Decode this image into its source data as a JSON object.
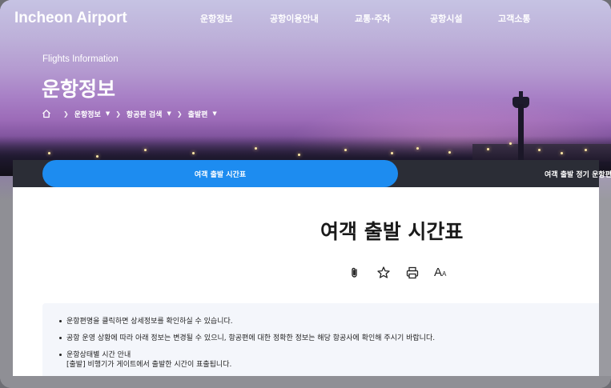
{
  "header": {
    "logo": "Incheon Airport",
    "nav": [
      {
        "label": "운항정보"
      },
      {
        "label": "공항이용안내"
      },
      {
        "label": "교통·주차"
      },
      {
        "label": "공항시설"
      },
      {
        "label": "고객소통"
      }
    ]
  },
  "hero": {
    "subtitle": "Flights Information",
    "title": "운항정보",
    "breadcrumb": [
      {
        "label": "운항정보"
      },
      {
        "label": "항공편 검색"
      },
      {
        "label": "출발편"
      }
    ]
  },
  "tabs": [
    {
      "label": "여객 출발 시간표",
      "active": true
    },
    {
      "label": "여객 출발 정기 운항편",
      "active": false
    }
  ],
  "main": {
    "title": "여객 출발 시간표",
    "tools": [
      {
        "icon": "link-icon"
      },
      {
        "icon": "star-icon"
      },
      {
        "icon": "print-icon"
      },
      {
        "icon": "font-size-icon",
        "label": "A",
        "label_small": "A"
      }
    ],
    "notice": [
      {
        "text": "운항편명을 클릭하면 상세정보를 확인하실 수 있습니다."
      },
      {
        "text": "공항 운영 상황에 따라 아래 정보는 변경될 수 있으니, 항공편에 대한 정확한 정보는 해당 항공사에 확인해 주시기 바랍니다."
      },
      {
        "text": "운항상태별 시간 안내",
        "sub": "[출발] 비행기가 게이트에서 출발한 시간이 표출됩니다."
      }
    ]
  },
  "colors": {
    "accent": "#1d8cf0",
    "tabbar": "#2b2d36",
    "notice_bg": "#f4f6fb"
  }
}
